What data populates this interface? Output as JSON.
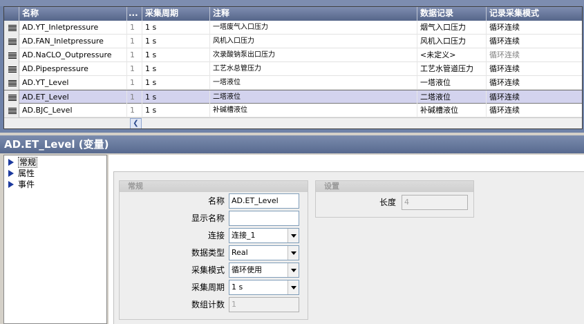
{
  "grid": {
    "columns": [
      "名称",
      "...",
      "采集周期",
      "注释",
      "数据记录",
      "记录采集模式"
    ],
    "rows": [
      {
        "name": "AD.YT_Inletpressure",
        "count": "1",
        "cycle": "1 s",
        "comment": "一塔废气入口压力",
        "log": "烟气入口压力",
        "mode": "循环连续",
        "selected": false
      },
      {
        "name": "AD.FAN_Inletpressure",
        "count": "1",
        "cycle": "1 s",
        "comment": "风机入口压力",
        "log": "风机入口压力",
        "mode": "循环连续",
        "selected": false
      },
      {
        "name": "AD.NaCLO_Outpressure",
        "count": "1",
        "cycle": "1 s",
        "comment": "次录酸钠泵出口压力",
        "log": "<未定义>",
        "mode": "循环连续",
        "selected": false,
        "mode_gray": true
      },
      {
        "name": "AD.Pipespressure",
        "count": "1",
        "cycle": "1 s",
        "comment": "工艺水总管压力",
        "log": "工艺水管道压力",
        "mode": "循环连续",
        "selected": false
      },
      {
        "name": "AD.YT_Level",
        "count": "1",
        "cycle": "1 s",
        "comment": "一塔液位",
        "log": "一塔液位",
        "mode": "循环连续",
        "selected": false
      },
      {
        "name": "AD.ET_Level",
        "count": "1",
        "cycle": "1 s",
        "comment": "二塔液位",
        "log": "二塔液位",
        "mode": "循环连续",
        "selected": true
      },
      {
        "name": "AD.BJC_Level",
        "count": "1",
        "cycle": "1 s",
        "comment": "补碱槽液位",
        "log": "补碱槽液位",
        "mode": "循环连续",
        "selected": false
      }
    ]
  },
  "title": "AD.ET_Level (变量)",
  "tree": [
    "常规",
    "属性",
    "事件"
  ],
  "general": {
    "group_title": "常规",
    "name_label": "名称",
    "name_value": "AD.ET_Level",
    "display_label": "显示名称",
    "display_value": "",
    "conn_label": "连接",
    "conn_value": "连接_1",
    "type_label": "数据类型",
    "type_value": "Real",
    "acq_mode_label": "采集模式",
    "acq_mode_value": "循环使用",
    "acq_cycle_label": "采集周期",
    "acq_cycle_value": "1 s",
    "array_label": "数组计数",
    "array_value": "1"
  },
  "settings": {
    "group_title": "设置",
    "length_label": "长度",
    "length_value": "4"
  }
}
